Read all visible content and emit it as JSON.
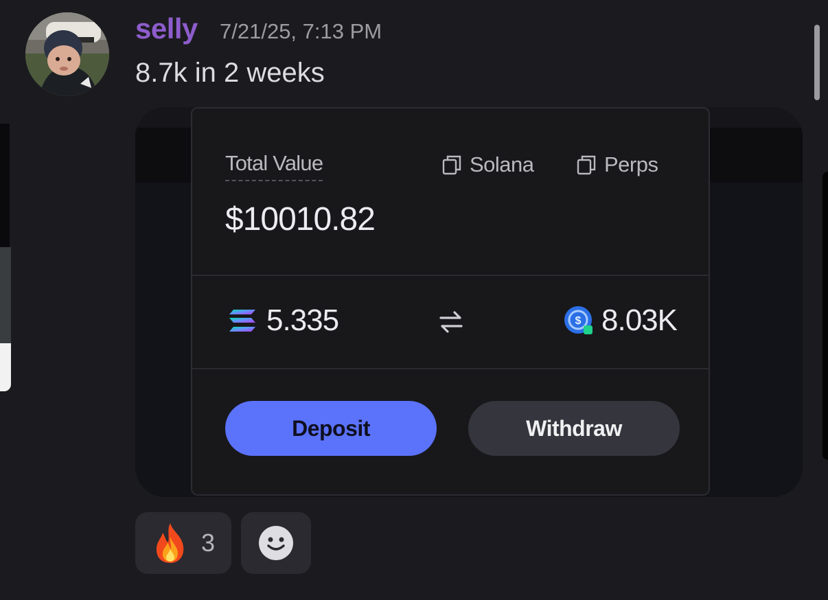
{
  "message": {
    "username": "selly",
    "timestamp": "7/21/25, 7:13 PM",
    "text": "8.7k in 2 weeks"
  },
  "card": {
    "total_label": "Total Value",
    "tags": [
      "Solana",
      "Perps"
    ],
    "total_value": "$10010.82",
    "sol_amount": "5.335",
    "usd_amount": "8.03K",
    "deposit_label": "Deposit",
    "withdraw_label": "Withdraw"
  },
  "reactions": [
    {
      "emoji": "🔥",
      "count": "3"
    }
  ],
  "colors": {
    "username": "#8e5dcc",
    "deposit_button": "#5b72fb",
    "withdraw_button": "#34353d",
    "background": "#1b1b1f"
  },
  "icons": [
    "copy-icon",
    "solana-icon",
    "swap-icon",
    "usd-coin-icon",
    "fire-emoji",
    "add-reaction-icon"
  ]
}
